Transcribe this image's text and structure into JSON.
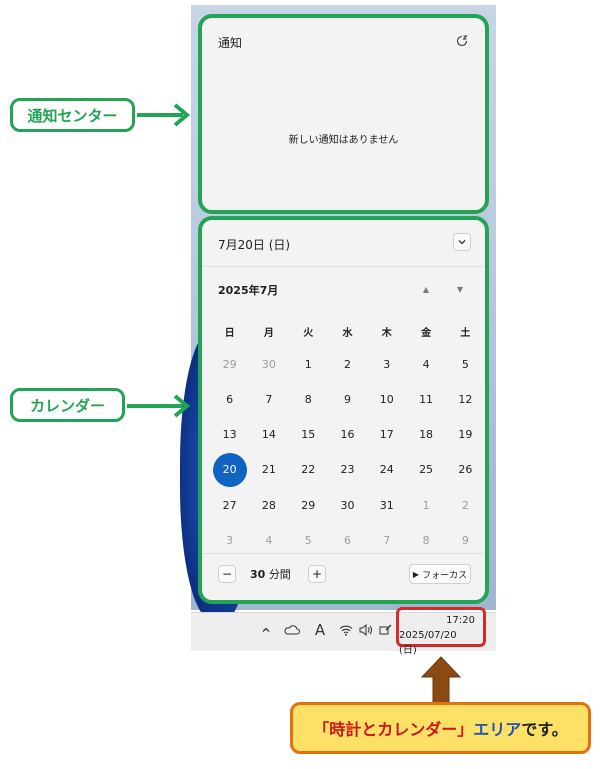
{
  "notification_center": {
    "title": "通知",
    "empty_message": "新しい通知はありません"
  },
  "calendar": {
    "header_date": "7月20日 (日)",
    "month_label": "2025年7月",
    "weekdays": [
      "日",
      "月",
      "火",
      "水",
      "木",
      "金",
      "土"
    ],
    "weeks": [
      [
        {
          "d": "29",
          "muted": true
        },
        {
          "d": "30",
          "muted": true
        },
        {
          "d": "1"
        },
        {
          "d": "2"
        },
        {
          "d": "3"
        },
        {
          "d": "4"
        },
        {
          "d": "5"
        }
      ],
      [
        {
          "d": "6"
        },
        {
          "d": "7"
        },
        {
          "d": "8"
        },
        {
          "d": "9"
        },
        {
          "d": "10"
        },
        {
          "d": "11"
        },
        {
          "d": "12"
        }
      ],
      [
        {
          "d": "13"
        },
        {
          "d": "14"
        },
        {
          "d": "15"
        },
        {
          "d": "16"
        },
        {
          "d": "17"
        },
        {
          "d": "18"
        },
        {
          "d": "19"
        }
      ],
      [
        {
          "d": "20",
          "today": true
        },
        {
          "d": "21"
        },
        {
          "d": "22"
        },
        {
          "d": "23"
        },
        {
          "d": "24"
        },
        {
          "d": "25"
        },
        {
          "d": "26"
        }
      ],
      [
        {
          "d": "27"
        },
        {
          "d": "28"
        },
        {
          "d": "29"
        },
        {
          "d": "30"
        },
        {
          "d": "31"
        },
        {
          "d": "1",
          "muted": true
        },
        {
          "d": "2",
          "muted": true
        }
      ],
      [
        {
          "d": "3",
          "muted": true
        },
        {
          "d": "4",
          "muted": true
        },
        {
          "d": "5",
          "muted": true
        },
        {
          "d": "6",
          "muted": true
        },
        {
          "d": "7",
          "muted": true
        },
        {
          "d": "8",
          "muted": true
        },
        {
          "d": "9",
          "muted": true
        }
      ]
    ],
    "focus": {
      "minutes_value": "30",
      "minutes_unit": "分間",
      "minus_label": "−",
      "plus_label": "+",
      "focus_button_label": "フォーカス"
    }
  },
  "taskbar": {
    "time": "17:20",
    "date": "2025/07/20 (日)",
    "tray_icons": [
      "chevron-up-icon",
      "onedrive-icon",
      "ime-icon",
      "wifi-icon",
      "volume-icon",
      "pen-icon"
    ],
    "ime_label": "A"
  },
  "annotations": {
    "notification_label": "通知センター",
    "calendar_label": "カレンダー",
    "callout_part1": "「時計とカレンダー」",
    "callout_part2": "エリア",
    "callout_part3": "です。"
  },
  "colors": {
    "accent_green": "#23a455",
    "highlight_red": "#d52b2b",
    "today_blue": "#0f64c2",
    "callout_fill": "#fde066",
    "callout_border": "#e57012"
  }
}
